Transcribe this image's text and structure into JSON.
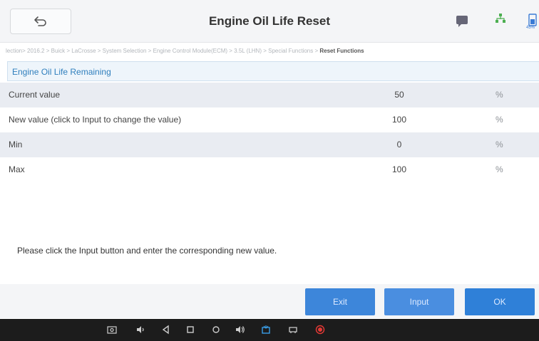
{
  "header": {
    "title": "Engine Oil Life Reset",
    "battery_text": "45%"
  },
  "breadcrumb": {
    "path": "lection> 2016.2 > Buick > LaCrosse > System Selection > Engine Control Module(ECM) > 3.5L (LHN) > Special Functions > ",
    "current": "Reset Functions"
  },
  "section": {
    "title": "Engine Oil Life Remaining"
  },
  "rows": [
    {
      "name": "Current value",
      "value": "50",
      "unit": "%"
    },
    {
      "name": "New value (click to Input to change the value)",
      "value": "100",
      "unit": "%"
    },
    {
      "name": "Min",
      "value": "0",
      "unit": "%"
    },
    {
      "name": "Max",
      "value": "100",
      "unit": "%"
    }
  ],
  "hint": "Please click the Input button and enter the corresponding new value.",
  "buttons": {
    "exit": "Exit",
    "input": "Input",
    "ok": "OK"
  },
  "icons": {
    "back": "back-arrow-icon",
    "chat": "chat-icon",
    "network": "network-icon",
    "battery": "battery-icon"
  },
  "colors": {
    "accent": "#2f80d8",
    "section_text": "#2f7fbd"
  }
}
